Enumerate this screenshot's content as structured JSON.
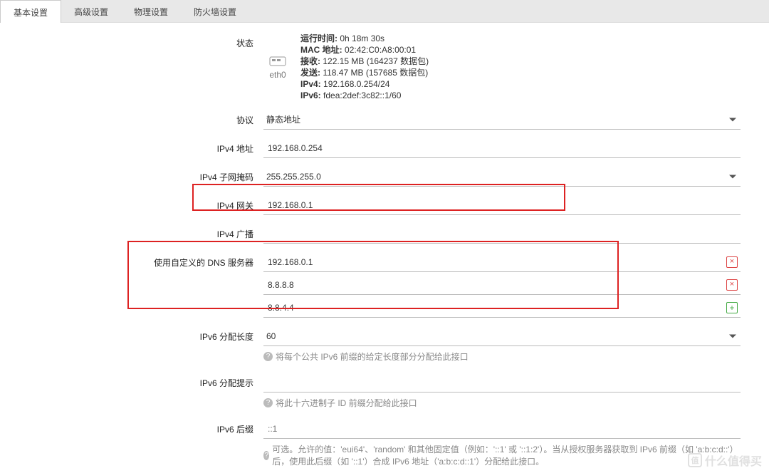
{
  "tabs": [
    {
      "label": "基本设置",
      "active": true
    },
    {
      "label": "高级设置",
      "active": false
    },
    {
      "label": "物理设置",
      "active": false
    },
    {
      "label": "防火墙设置",
      "active": false
    }
  ],
  "status": {
    "label": "状态",
    "iface": "eth0",
    "uptime_label": "运行时间:",
    "uptime": "0h 18m 30s",
    "mac_label": "MAC 地址:",
    "mac": "02:42:C0:A8:00:01",
    "rx_label": "接收:",
    "rx": "122.15 MB (164237 数据包)",
    "tx_label": "发送:",
    "tx": "118.47 MB (157685 数据包)",
    "ipv4_label": "IPv4:",
    "ipv4": "192.168.0.254/24",
    "ipv6_label": "IPv6:",
    "ipv6": "fdea:2def:3c82::1/60"
  },
  "proto": {
    "label": "协议",
    "value": "静态地址"
  },
  "ipv4addr": {
    "label": "IPv4 地址",
    "value": "192.168.0.254"
  },
  "ipv4mask": {
    "label": "IPv4 子网掩码",
    "value": "255.255.255.0"
  },
  "ipv4gw": {
    "label": "IPv4 网关",
    "value": "192.168.0.1"
  },
  "ipv4bc": {
    "label": "IPv4 广播",
    "value": ""
  },
  "dns": {
    "label": "使用自定义的 DNS 服务器",
    "items": [
      "192.168.0.1",
      "8.8.8.8",
      "8.8.4.4"
    ]
  },
  "ipv6len": {
    "label": "IPv6 分配长度",
    "value": "60",
    "hint": "将每个公共 IPv6 前缀的给定长度部分分配给此接口"
  },
  "ipv6hint": {
    "label": "IPv6 分配提示",
    "value": "",
    "hint": "将此十六进制子 ID 前缀分配给此接口"
  },
  "ipv6suffix": {
    "label": "IPv6 后缀",
    "value": "::1",
    "hint": "可选。允许的值：'eui64'、'random' 和其他固定值（例如：'::1' 或 '::1:2'）。当从授权服务器获取到 IPv6 前缀（如 'a:b:c:d::'）后，使用此后缀（如 '::1'）合成 IPv6 地址（'a:b:c:d::1'）分配给此接口。"
  },
  "watermark": "什么值得买"
}
